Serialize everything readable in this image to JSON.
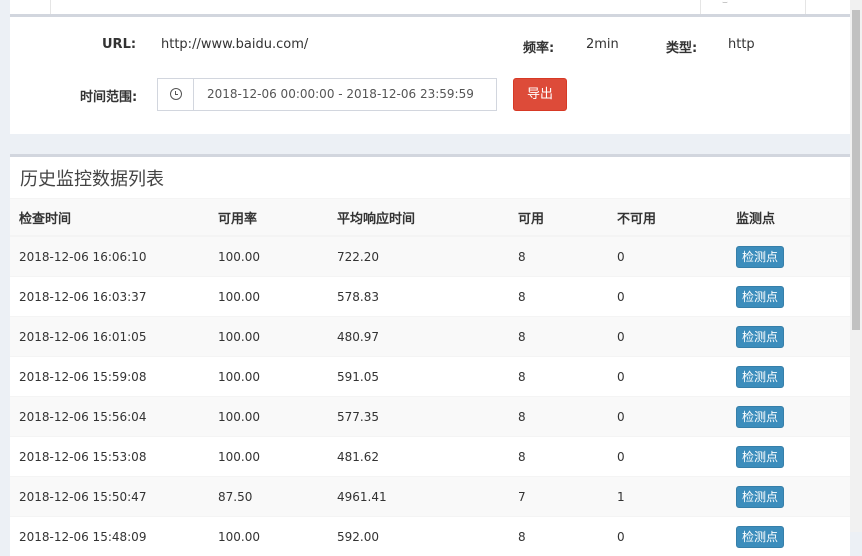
{
  "filter": {
    "url_label": "URL:",
    "url_value": "http://www.baidu.com/",
    "freq_label": "频率:",
    "freq_value": "2min",
    "type_label": "类型:",
    "type_value": "http",
    "time_label": "时间范围:",
    "time_range": "2018-12-06 00:00:00 - 2018-12-06 23:59:59",
    "export_label": "导出"
  },
  "table": {
    "title": "历史监控数据列表",
    "headers": [
      "检查时间",
      "可用率",
      "平均响应时间",
      "可用",
      "不可用",
      "监测点"
    ],
    "rows": [
      {
        "time": "2018-12-06 16:06:10",
        "rate": "100.00",
        "avg": "722.20",
        "ok": "8",
        "fail": "0",
        "btn": "检测点"
      },
      {
        "time": "2018-12-06 16:03:37",
        "rate": "100.00",
        "avg": "578.83",
        "ok": "8",
        "fail": "0",
        "btn": "检测点"
      },
      {
        "time": "2018-12-06 16:01:05",
        "rate": "100.00",
        "avg": "480.97",
        "ok": "8",
        "fail": "0",
        "btn": "检测点"
      },
      {
        "time": "2018-12-06 15:59:08",
        "rate": "100.00",
        "avg": "591.05",
        "ok": "8",
        "fail": "0",
        "btn": "检测点"
      },
      {
        "time": "2018-12-06 15:56:04",
        "rate": "100.00",
        "avg": "577.35",
        "ok": "8",
        "fail": "0",
        "btn": "检测点"
      },
      {
        "time": "2018-12-06 15:53:08",
        "rate": "100.00",
        "avg": "481.62",
        "ok": "8",
        "fail": "0",
        "btn": "检测点"
      },
      {
        "time": "2018-12-06 15:50:47",
        "rate": "87.50",
        "avg": "4961.41",
        "ok": "7",
        "fail": "1",
        "btn": "检测点"
      },
      {
        "time": "2018-12-06 15:48:09",
        "rate": "100.00",
        "avg": "592.00",
        "ok": "8",
        "fail": "0",
        "btn": "检测点"
      }
    ]
  }
}
